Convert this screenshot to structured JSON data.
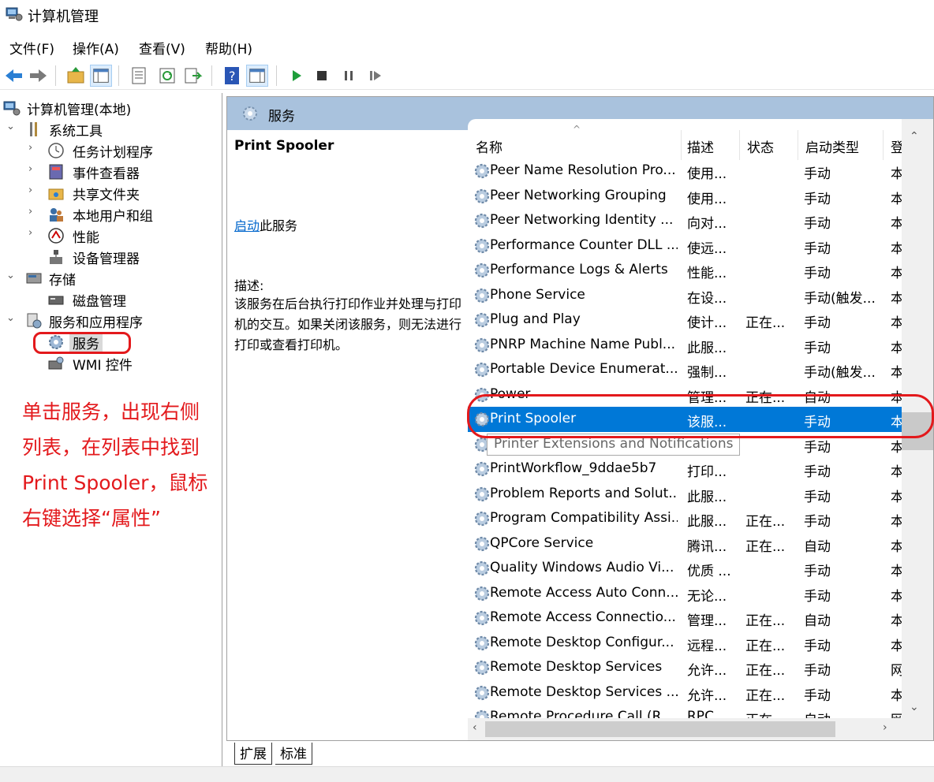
{
  "window": {
    "title": "计算机管理"
  },
  "menu": [
    "文件(F)",
    "操作(A)",
    "查看(V)",
    "帮助(H)"
  ],
  "toolbar": {
    "icons": [
      "back-icon",
      "forward-icon",
      "up-folder-icon",
      "show-tree-icon",
      "properties-icon",
      "refresh-icon",
      "export-list-icon",
      "help-icon",
      "action-pane-icon",
      "play-icon",
      "stop-icon",
      "pause-icon",
      "resume-icon"
    ]
  },
  "tree": {
    "root": "计算机管理(本地)",
    "items": [
      {
        "label": "系统工具"
      },
      {
        "label": "任务计划程序"
      },
      {
        "label": "事件查看器"
      },
      {
        "label": "共享文件夹"
      },
      {
        "label": "本地用户和组"
      },
      {
        "label": "性能"
      },
      {
        "label": "设备管理器"
      },
      {
        "label": "存储"
      },
      {
        "label": "磁盘管理"
      },
      {
        "label": "服务和应用程序"
      },
      {
        "label": "服务"
      },
      {
        "label": "WMI 控件"
      }
    ]
  },
  "annotation": {
    "text_lines": [
      "单击服务，出现右侧",
      "列表，在列表中找到",
      "Print Spooler，鼠标",
      "右键选择“属性”"
    ],
    "color": "#e3191c"
  },
  "main": {
    "header": "服务",
    "desc": {
      "title": "Print Spooler",
      "link": "启动",
      "link_suffix": "此服务",
      "label": "描述:",
      "body": "该服务在后台执行打印作业并处理与打印机的交互。如果关闭该服务，则无法进行打印或查看打印机。"
    },
    "columns": {
      "name": "名称",
      "desc": "描述",
      "status": "状态",
      "type": "启动类型",
      "logon": "登"
    },
    "rows": [
      {
        "name": "Peer Name Resolution Pro...",
        "desc": "使用...",
        "status": "",
        "type": "手动",
        "logon": "本"
      },
      {
        "name": "Peer Networking Grouping",
        "desc": "使用...",
        "status": "",
        "type": "手动",
        "logon": "本"
      },
      {
        "name": "Peer Networking Identity ...",
        "desc": "向对...",
        "status": "",
        "type": "手动",
        "logon": "本"
      },
      {
        "name": "Performance Counter DLL ...",
        "desc": "使远...",
        "status": "",
        "type": "手动",
        "logon": "本"
      },
      {
        "name": "Performance Logs & Alerts",
        "desc": "性能...",
        "status": "",
        "type": "手动",
        "logon": "本"
      },
      {
        "name": "Phone Service",
        "desc": "在设...",
        "status": "",
        "type": "手动(触发...",
        "logon": "本"
      },
      {
        "name": "Plug and Play",
        "desc": "使计...",
        "status": "正在...",
        "type": "手动",
        "logon": "本"
      },
      {
        "name": "PNRP Machine Name Publ...",
        "desc": "此服...",
        "status": "",
        "type": "手动",
        "logon": "本"
      },
      {
        "name": "Portable Device Enumerat...",
        "desc": "强制...",
        "status": "",
        "type": "手动(触发...",
        "logon": "本"
      },
      {
        "name": "Power",
        "desc": "管理...",
        "status": "正在...",
        "type": "自动",
        "logon": "本"
      },
      {
        "name": "Print Spooler",
        "desc": "该服...",
        "status": "",
        "type": "手动",
        "logon": "本"
      },
      {
        "name": "Printer Extensions and Notifications",
        "desc": "",
        "status": "",
        "type": "手动",
        "logon": "本"
      },
      {
        "name": "PrintWorkflow_9ddae5b7",
        "desc": "打印...",
        "status": "",
        "type": "手动",
        "logon": "本"
      },
      {
        "name": "Problem Reports and Solut...",
        "desc": "此服...",
        "status": "",
        "type": "手动",
        "logon": "本"
      },
      {
        "name": "Program Compatibility Assi...",
        "desc": "此服...",
        "status": "正在...",
        "type": "手动",
        "logon": "本"
      },
      {
        "name": "QPCore Service",
        "desc": "腾讯...",
        "status": "正在...",
        "type": "自动",
        "logon": "本"
      },
      {
        "name": "Quality Windows Audio Vi...",
        "desc": "优质 ...",
        "status": "",
        "type": "手动",
        "logon": "本"
      },
      {
        "name": "Remote Access Auto Conn...",
        "desc": "无论...",
        "status": "",
        "type": "手动",
        "logon": "本"
      },
      {
        "name": "Remote Access Connectio...",
        "desc": "管理...",
        "status": "正在...",
        "type": "自动",
        "logon": "本"
      },
      {
        "name": "Remote Desktop Configur...",
        "desc": "远程...",
        "status": "正在...",
        "type": "手动",
        "logon": "本"
      },
      {
        "name": "Remote Desktop Services",
        "desc": "允许...",
        "status": "正在...",
        "type": "手动",
        "logon": "网"
      },
      {
        "name": "Remote Desktop Services ...",
        "desc": "允许...",
        "status": "正在...",
        "type": "手动",
        "logon": "本"
      },
      {
        "name": "Remote Procedure Call (R...",
        "desc": "RPC...",
        "status": "正在...",
        "type": "自动",
        "logon": "网"
      }
    ],
    "selected_index": 10,
    "tooltip": "Printer Extensions and Notifications",
    "tabs": [
      "扩展",
      "标准"
    ]
  }
}
